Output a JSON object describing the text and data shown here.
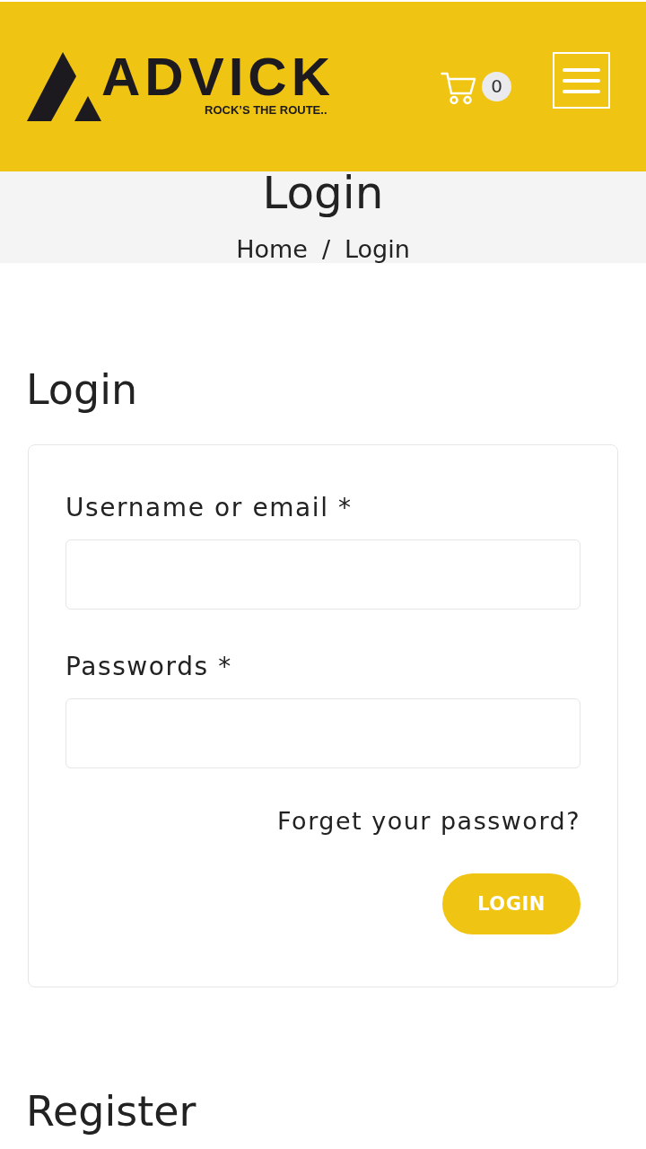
{
  "header": {
    "logo": {
      "name": "ADVICK",
      "tagline": "ROCK’S THE ROUTE.."
    },
    "cart_count": "0"
  },
  "page_banner": {
    "title": "Login",
    "breadcrumb": {
      "items": [
        "Home",
        "Login"
      ],
      "separator": "/"
    }
  },
  "login": {
    "heading": "Login",
    "fields": [
      {
        "label": "Username or email *"
      },
      {
        "label": "Passwords *"
      }
    ],
    "forgot_link": "Forget your password?",
    "submit": "LOGIN"
  },
  "register": {
    "heading": "Register"
  }
}
